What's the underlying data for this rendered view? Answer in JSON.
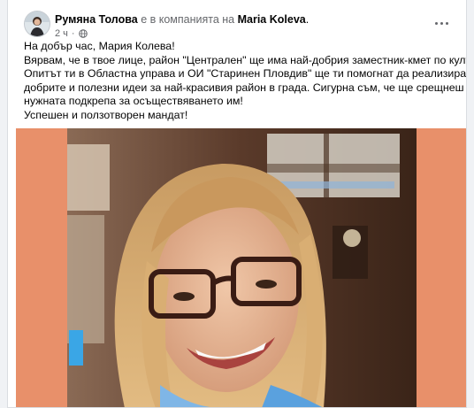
{
  "post": {
    "author": "Румяна Толова",
    "with_text": "е в компанията на",
    "tagged": "Maria Koleva",
    "tagged_suffix": ".",
    "time": "2 ч",
    "time_sep": "·",
    "privacy_icon": "globe-icon",
    "more_icon": "more-horizontal-icon",
    "lines": [
      "На добър час, Мария Колева!",
      "Вярвам, че в твое лице, район \"Централен\" ще има най-добрия заместник-кмет по култура.",
      "Опитът ти в  Областна управа и ОИ \"Старинен Пловдив\" ще ти помогнат да реализираш",
      "добрите и полезни идеи за най-красивия район в града. Сигурна съм, че ще срещнеш",
      "нужната подкрепа за осъществяването им!",
      "Успешен и ползотворен мандат!"
    ],
    "photo_background": "#e8906a"
  }
}
